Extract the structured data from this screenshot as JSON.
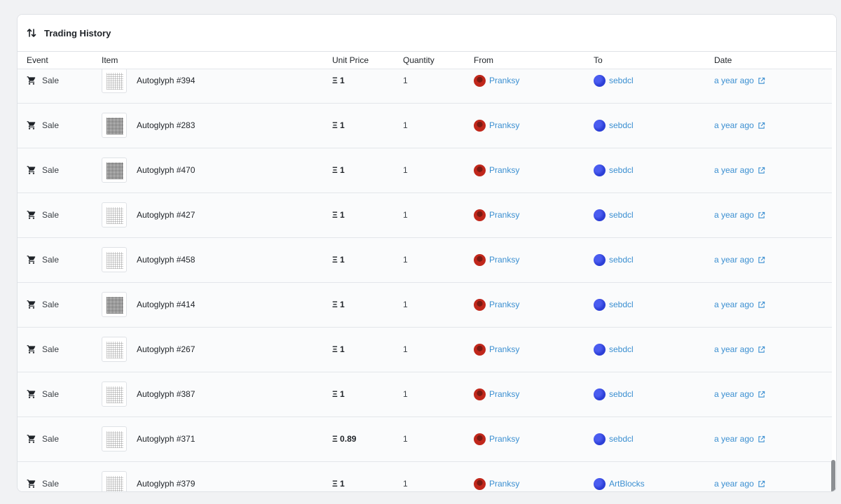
{
  "panel": {
    "title": "Trading History",
    "title_icon": "swap-vertical-icon"
  },
  "columns": {
    "event": "Event",
    "item": "Item",
    "unit_price": "Unit Price",
    "quantity": "Quantity",
    "from": "From",
    "to": "To",
    "date": "Date"
  },
  "colors": {
    "link": "#3b8fd1",
    "from_avatar": "#c0271b",
    "to_avatar": "#2c3fd6"
  },
  "rows": [
    {
      "event": "Sale",
      "item": "Autoglyph #394",
      "price": "Ξ 1",
      "qty": "1",
      "from": "Pranksy",
      "to": "sebdcl",
      "date": "a year ago",
      "dense": false
    },
    {
      "event": "Sale",
      "item": "Autoglyph #283",
      "price": "Ξ 1",
      "qty": "1",
      "from": "Pranksy",
      "to": "sebdcl",
      "date": "a year ago",
      "dense": true
    },
    {
      "event": "Sale",
      "item": "Autoglyph #470",
      "price": "Ξ 1",
      "qty": "1",
      "from": "Pranksy",
      "to": "sebdcl",
      "date": "a year ago",
      "dense": true
    },
    {
      "event": "Sale",
      "item": "Autoglyph #427",
      "price": "Ξ 1",
      "qty": "1",
      "from": "Pranksy",
      "to": "sebdcl",
      "date": "a year ago",
      "dense": false
    },
    {
      "event": "Sale",
      "item": "Autoglyph #458",
      "price": "Ξ 1",
      "qty": "1",
      "from": "Pranksy",
      "to": "sebdcl",
      "date": "a year ago",
      "dense": false
    },
    {
      "event": "Sale",
      "item": "Autoglyph #414",
      "price": "Ξ 1",
      "qty": "1",
      "from": "Pranksy",
      "to": "sebdcl",
      "date": "a year ago",
      "dense": true
    },
    {
      "event": "Sale",
      "item": "Autoglyph #267",
      "price": "Ξ 1",
      "qty": "1",
      "from": "Pranksy",
      "to": "sebdcl",
      "date": "a year ago",
      "dense": false
    },
    {
      "event": "Sale",
      "item": "Autoglyph #387",
      "price": "Ξ 1",
      "qty": "1",
      "from": "Pranksy",
      "to": "sebdcl",
      "date": "a year ago",
      "dense": false
    },
    {
      "event": "Sale",
      "item": "Autoglyph #371",
      "price": "Ξ 0.89",
      "qty": "1",
      "from": "Pranksy",
      "to": "sebdcl",
      "date": "a year ago",
      "dense": false
    },
    {
      "event": "Sale",
      "item": "Autoglyph #379",
      "price": "Ξ 1",
      "qty": "1",
      "from": "Pranksy",
      "to": "ArtBlocks",
      "date": "a year ago",
      "dense": false
    }
  ]
}
